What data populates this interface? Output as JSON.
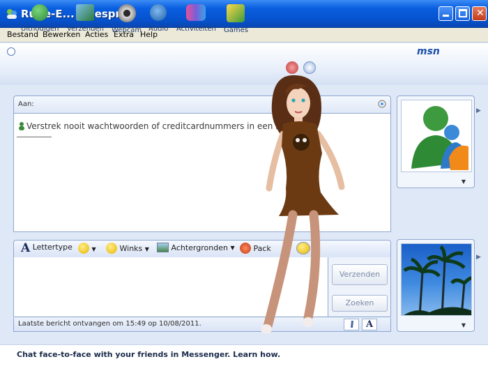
{
  "window": {
    "title": "Rude-E... - Gesprek"
  },
  "menu": [
    "Bestand",
    "Bewerken",
    "Acties",
    "Extra",
    "Help"
  ],
  "toolbar": {
    "items": [
      {
        "label": "Uitnodigen",
        "icon": "invite-icon"
      },
      {
        "label": "Verzenden",
        "icon": "send-files-icon"
      },
      {
        "label": "Webcam",
        "icon": "webcam-icon"
      },
      {
        "label": "Audio",
        "icon": "audio-icon"
      },
      {
        "label": "Activiteiten",
        "icon": "activities-icon"
      },
      {
        "label": "Games",
        "icon": "games-icon"
      }
    ],
    "brand": "msn"
  },
  "conversation": {
    "to_label": "Aan:",
    "warning": "Verstrek nooit wachtwoorden of creditcardnummers in een ber"
  },
  "format_bar": {
    "font_label": "Lettertype",
    "winks_label": "Winks",
    "backgrounds_label": "Achtergronden",
    "packs_label": "Pack"
  },
  "buttons": {
    "send": "Verzenden",
    "search": "Zoeken"
  },
  "status": {
    "last_message": "Laatste bericht ontvangen om 15:49 op 10/08/2011."
  },
  "footer": {
    "ad_text": "Chat face-to-face with your friends in Messenger. Learn how."
  },
  "colors": {
    "titlebar": "#0653cf",
    "panel_border": "#8ea6cf",
    "background": "#dfe8f7"
  }
}
